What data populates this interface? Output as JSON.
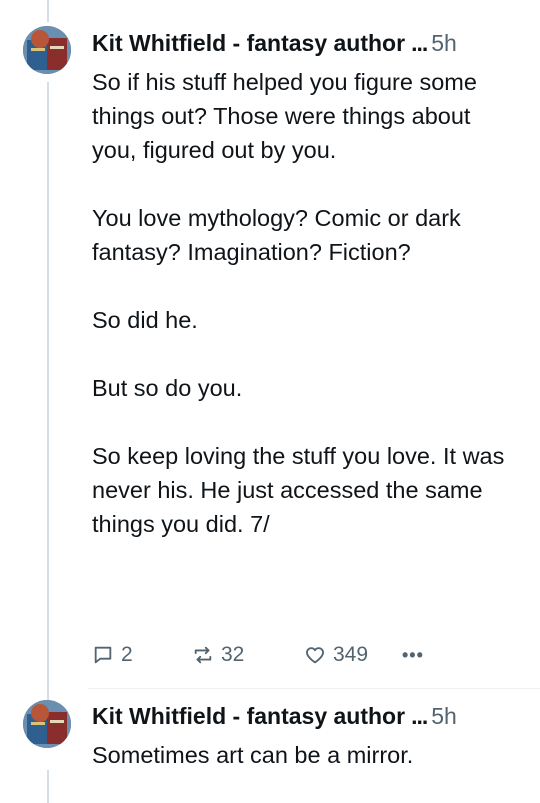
{
  "posts": [
    {
      "author": "Kit Whitfield - fantasy author",
      "ellipsis": "...",
      "time": "5h",
      "paragraphs": [
        "So if his stuff helped you figure some things out? Those were things about you, figured out by you.",
        "You love mythology? Comic or dark fantasy? Imagination? Fiction?",
        "So did he.",
        "But so do you.",
        "So keep loving the stuff you love. It was never his. He just accessed the same things you did. 7/"
      ],
      "replies": "2",
      "reposts": "32",
      "likes": "349",
      "more": "•••"
    },
    {
      "author": "Kit Whitfield - fantasy author",
      "ellipsis": "...",
      "time": "5h",
      "paragraphs": [
        "Sometimes art can be a mirror."
      ]
    }
  ],
  "icons": {
    "reply": "speech-bubble-icon",
    "repost": "repost-arrows-icon",
    "like": "heart-icon",
    "more": "ellipsis-icon"
  },
  "colors": {
    "text": "#0f1419",
    "muted": "#536471",
    "thread_line": "#d6dde3"
  }
}
